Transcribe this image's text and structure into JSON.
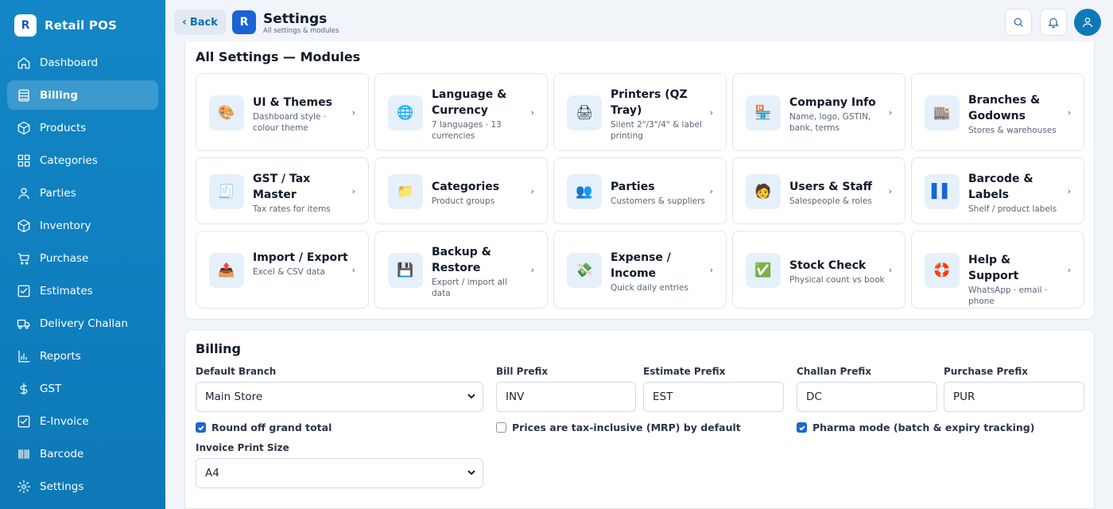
{
  "app": {
    "logo_letter": "R",
    "name": "Retail POS"
  },
  "sidebar": {
    "items": [
      {
        "label": "Dashboard",
        "icon": "home-icon",
        "active": false
      },
      {
        "label": "Billing",
        "icon": "billing-icon",
        "active": true
      },
      {
        "label": "Products",
        "icon": "box-icon",
        "active": false
      },
      {
        "label": "Categories",
        "icon": "grid-icon",
        "active": false
      },
      {
        "label": "Parties",
        "icon": "user-icon",
        "active": false
      },
      {
        "label": "Inventory",
        "icon": "cube-icon",
        "active": false
      },
      {
        "label": "Purchase",
        "icon": "cart-icon",
        "active": false
      },
      {
        "label": "Estimates",
        "icon": "checklist-icon",
        "active": false
      },
      {
        "label": "Delivery Challan",
        "icon": "truck-icon",
        "active": false
      },
      {
        "label": "Reports",
        "icon": "bar-chart-icon",
        "active": false
      },
      {
        "label": "GST",
        "icon": "rupee-icon",
        "active": false
      },
      {
        "label": "E-Invoice",
        "icon": "invoice-icon",
        "active": false
      },
      {
        "label": "Barcode",
        "icon": "barcode-icon",
        "active": false
      },
      {
        "label": "Settings",
        "icon": "gear-icon",
        "active": false
      }
    ]
  },
  "header": {
    "back_label": "Back",
    "logo_letter": "R",
    "title": "Settings",
    "subtitle": "All settings & modules"
  },
  "modules": {
    "title": "All Settings — Modules",
    "cards": [
      {
        "title": "UI & Themes",
        "sub": "Dashboard style · colour theme",
        "icon": "🎨"
      },
      {
        "title": "Language & Currency",
        "sub": "7 languages · 13 currencies",
        "icon": "🌐"
      },
      {
        "title": "Printers (QZ Tray)",
        "sub": "Silent 2\"/3\"/4\" & label printing",
        "icon": "🖨"
      },
      {
        "title": "Company Info",
        "sub": "Name, logo, GSTIN, bank, terms",
        "icon": "🏪"
      },
      {
        "title": "Branches & Godowns",
        "sub": "Stores & warehouses",
        "icon": "🏬"
      },
      {
        "title": "GST / Tax Master",
        "sub": "Tax rates for items",
        "icon": "🧾"
      },
      {
        "title": "Categories",
        "sub": "Product groups",
        "icon": "📁"
      },
      {
        "title": "Parties",
        "sub": "Customers & suppliers",
        "icon": "👥"
      },
      {
        "title": "Users & Staff",
        "sub": "Salespeople & roles",
        "icon": "🧑"
      },
      {
        "title": "Barcode & Labels",
        "sub": "Shelf / product labels",
        "icon": "▌▌"
      },
      {
        "title": "Import / Export",
        "sub": "Excel & CSV data",
        "icon": "📤"
      },
      {
        "title": "Backup & Restore",
        "sub": "Export / import all data",
        "icon": "💾"
      },
      {
        "title": "Expense / Income",
        "sub": "Quick daily entries",
        "icon": "💸"
      },
      {
        "title": "Stock Check",
        "sub": "Physical count vs book",
        "icon": "✅"
      },
      {
        "title": "Help & Support",
        "sub": "WhatsApp · email · phone",
        "icon": "🛟"
      }
    ]
  },
  "billing": {
    "title": "Billing",
    "default_branch": {
      "label": "Default Branch",
      "value": "Main Store"
    },
    "bill_prefix": {
      "label": "Bill Prefix",
      "value": "INV"
    },
    "estimate_prefix": {
      "label": "Estimate Prefix",
      "value": "EST"
    },
    "challan_prefix": {
      "label": "Challan Prefix",
      "value": "DC"
    },
    "purchase_prefix": {
      "label": "Purchase Prefix",
      "value": "PUR"
    },
    "round_off": {
      "label": "Round off grand total",
      "checked": true
    },
    "tax_inclusive": {
      "label": "Prices are tax-inclusive (MRP) by default",
      "checked": false
    },
    "pharma_mode": {
      "label": "Pharma mode (batch & expiry tracking)",
      "checked": true
    },
    "print_size": {
      "label": "Invoice Print Size",
      "value": "A4"
    }
  }
}
